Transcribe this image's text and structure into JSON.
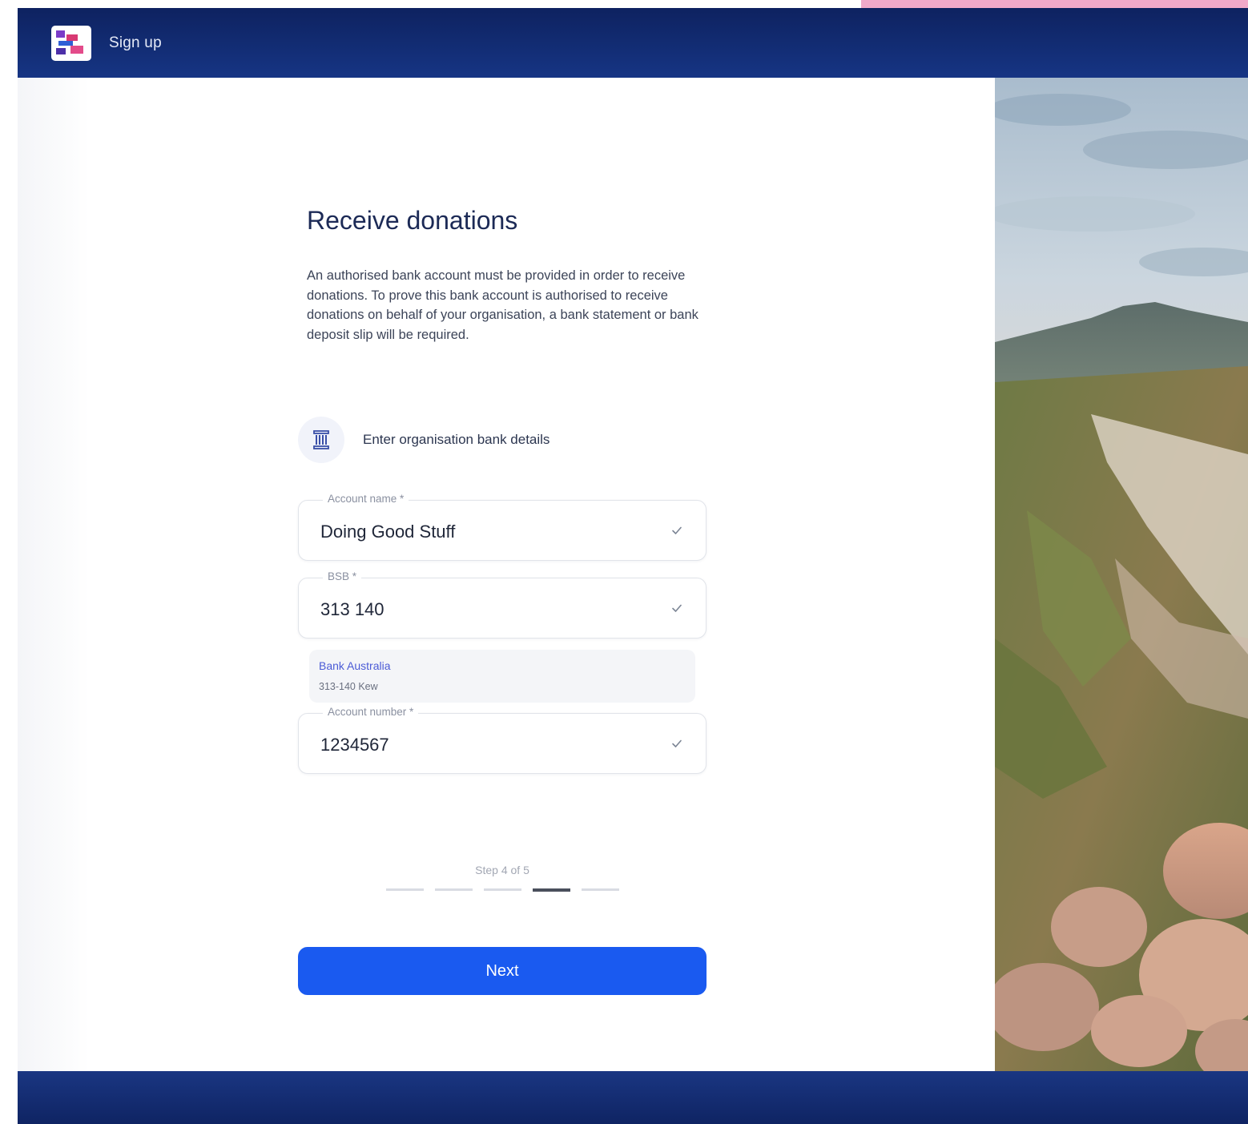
{
  "header": {
    "title": "Sign up"
  },
  "form": {
    "heading": "Receive donations",
    "description": "An authorised bank account must be provided in order to receive donations. To prove this bank account is authorised to receive donations on behalf of your organisation, a bank statement or bank deposit slip will be required.",
    "bank_section_label": "Enter organisation bank details",
    "bank_section_icon": "bank-icon",
    "fields": [
      {
        "label": "Account name *",
        "value": "Doing Good Stuff",
        "status_icon": "check-icon"
      },
      {
        "label": "BSB *",
        "value": "313 140",
        "status_icon": "check-icon"
      },
      {
        "label": "Account number *",
        "value": "1234567",
        "status_icon": "check-icon"
      }
    ],
    "bank_lookup": {
      "bank_name": "Bank Australia",
      "branch": "313-140 Kew"
    },
    "step": {
      "text": "Step 4 of 5",
      "current": 4,
      "total": 5
    },
    "next_label": "Next"
  },
  "colors": {
    "header_bg": "#122a70",
    "primary_button": "#1a5af0",
    "heading_text": "#1c2a56",
    "bank_name_link": "#4b5bd6"
  }
}
